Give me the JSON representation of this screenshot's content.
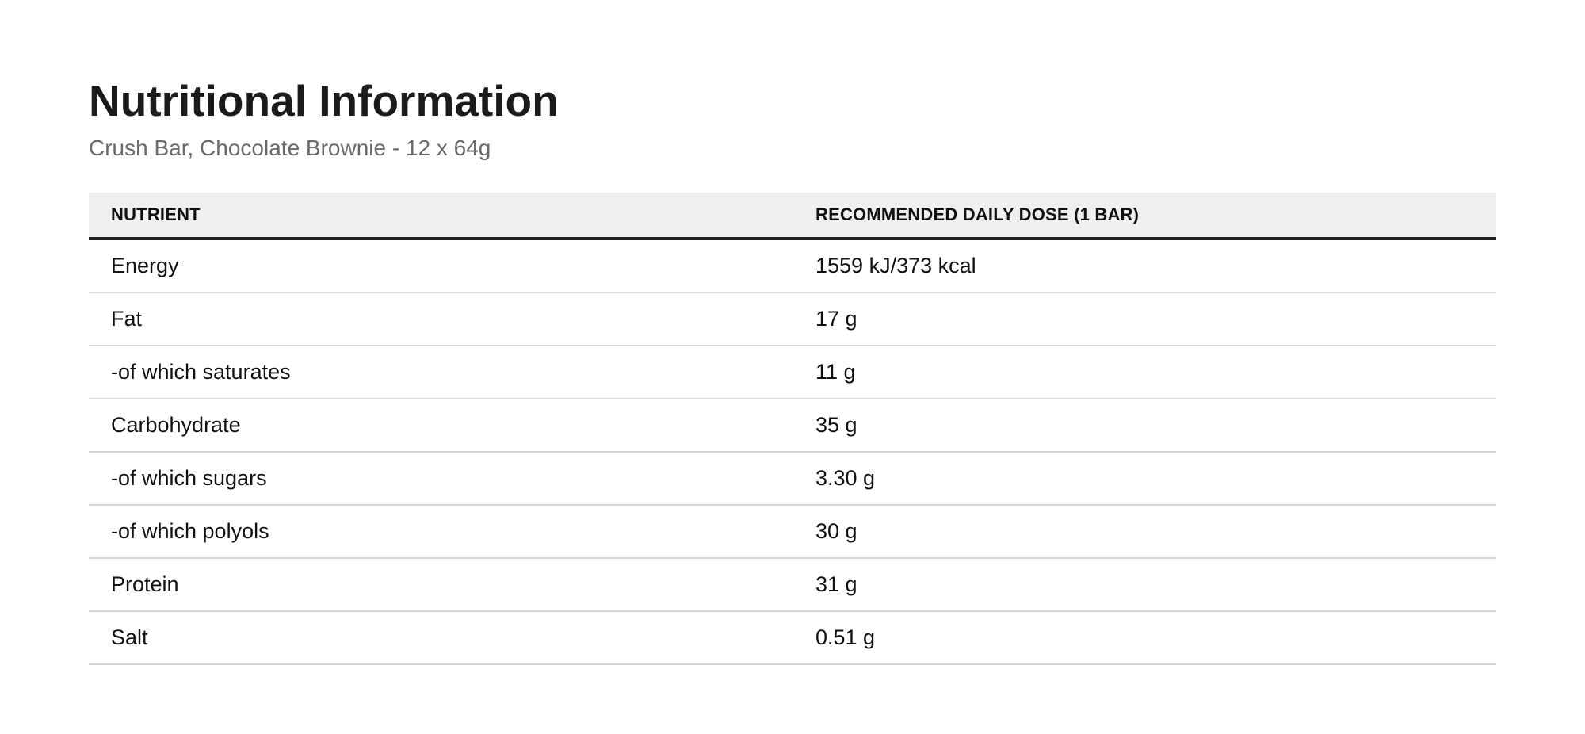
{
  "header": {
    "title": "Nutritional Information",
    "subtitle": "Crush Bar, Chocolate Brownie - 12 x 64g"
  },
  "table": {
    "columns": [
      "NUTRIENT",
      "RECOMMENDED DAILY DOSE (1 BAR)"
    ],
    "rows": [
      [
        "Energy",
        "1559 kJ/373 kcal"
      ],
      [
        "Fat",
        "17 g"
      ],
      [
        "-of which saturates",
        "11 g"
      ],
      [
        "Carbohydrate",
        "35 g"
      ],
      [
        "-of which sugars",
        "3.30 g"
      ],
      [
        "-of which polyols",
        "30 g"
      ],
      [
        "Protein",
        "31 g"
      ],
      [
        "Salt",
        "0.51 g"
      ]
    ]
  },
  "colors": {
    "header_background": "#efefef",
    "header_rule": "#1e1e1e",
    "row_rule": "#d6d6d6",
    "subtitle_text": "#6a6a6a"
  }
}
